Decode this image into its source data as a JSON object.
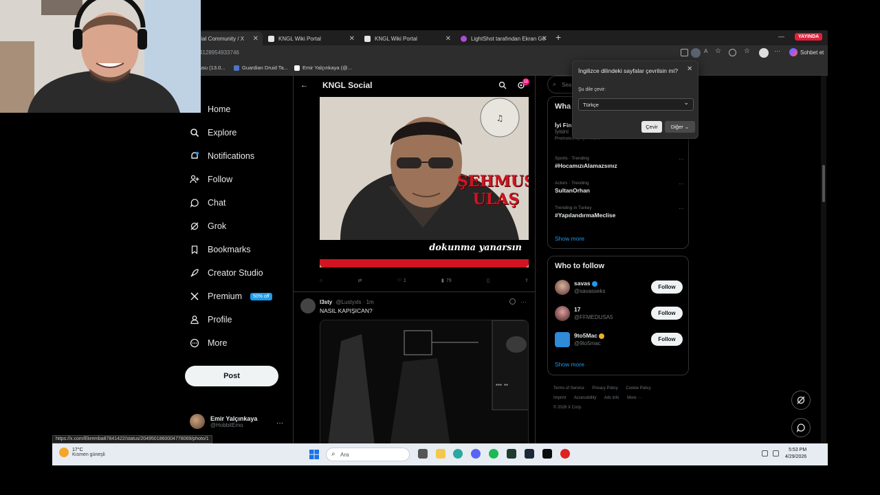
{
  "browser": {
    "tabs": [
      {
        "label": "ocial Community / X"
      },
      {
        "label": "KNGL Wiki Portal"
      },
      {
        "label": "KNGL Wiki Portal"
      },
      {
        "label": "LightShot tarafından Ekran Görünt"
      }
    ],
    "live_badge": "YAYINDA",
    "url": "4128954933746",
    "copilot_label": "Sohbet et",
    "bookmarks": [
      "usu (13.0...",
      "Guardian Druid Ta...",
      "Emir Yalçınkaya (@..."
    ]
  },
  "translate_popup": {
    "question": "İngilizce dilindeki sayfalar çevrilsin mi?",
    "label": "Şu dile çevir:",
    "selected_language": "Türkçe",
    "translate_button": "Çevir",
    "more_button": "Diğer"
  },
  "nav": {
    "items": [
      {
        "label": "Home",
        "icon": "home-icon"
      },
      {
        "label": "Explore",
        "icon": "search-icon"
      },
      {
        "label": "Notifications",
        "icon": "bell-icon"
      },
      {
        "label": "Follow",
        "icon": "person-plus-icon"
      },
      {
        "label": "Chat",
        "icon": "chat-icon"
      },
      {
        "label": "Grok",
        "icon": "grok-icon"
      },
      {
        "label": "Bookmarks",
        "icon": "bookmark-icon"
      },
      {
        "label": "Creator Studio",
        "icon": "rocket-icon"
      },
      {
        "label": "Premium",
        "icon": "x-logo-icon"
      },
      {
        "label": "Profile",
        "icon": "person-icon"
      },
      {
        "label": "More",
        "icon": "more-circle-icon"
      }
    ],
    "premium_badge": "50% off",
    "post_button": "Post",
    "account_name": "Emir Yalçınkaya",
    "account_handle": "@HobbitEmo"
  },
  "community": {
    "title": "KNGL Social",
    "notification_count": "11",
    "cover_name_line1": "ŞEHMUS",
    "cover_name_line2": "ULAŞ",
    "cover_slogan": "dokunma yanarsın",
    "post_actions": {
      "likes": "1",
      "views": "79"
    }
  },
  "tweet2": {
    "name": "l3sty",
    "handle": "@Lustyxls",
    "time": "1m",
    "text": "NASIL KAPIŞICAN?"
  },
  "right": {
    "search_placeholder": "Sea",
    "whats_title": "Wha",
    "promo_name": "İyi Fin",
    "promo_sub": "İyisini",
    "promo_note": "Promoted by İyi Finans",
    "trends": [
      {
        "category": "Sports · Trending",
        "name": "#HocamızıAlamazsınız"
      },
      {
        "category": "Actors · Trending",
        "name": "SultanOrhan"
      },
      {
        "category": "Trending in Turkey",
        "name": "#YapılandırmaMeclise"
      }
    ],
    "show_more": "Show more",
    "who_title": "Who to follow",
    "who": [
      {
        "name": "savas",
        "handle": "@savasseks",
        "verified": "blue"
      },
      {
        "name": "17",
        "handle": "@FFMEDUSA5",
        "verified": ""
      },
      {
        "name": "9to5Mac",
        "handle": "@9to5mac",
        "verified": "gold"
      }
    ],
    "follow_label": "Follow",
    "footer": [
      "Terms of Service",
      "Privacy Policy",
      "Cookie Policy",
      "Imprint",
      "Accessibility",
      "Ads info",
      "More ···",
      "© 2026 X Corp."
    ]
  },
  "status_url": "https://x.com/Ekremba87841422/status/2049501860004778069/photo/1",
  "taskbar": {
    "temp": "17°C",
    "weather": "Kısmen güneşli",
    "search_placeholder": "Ara",
    "time": "5:53 PM",
    "date": "4/29/2026"
  },
  "colors": {
    "accent": "#1d9bf0",
    "live": "#e0203a",
    "cover_red": "#d11422"
  }
}
